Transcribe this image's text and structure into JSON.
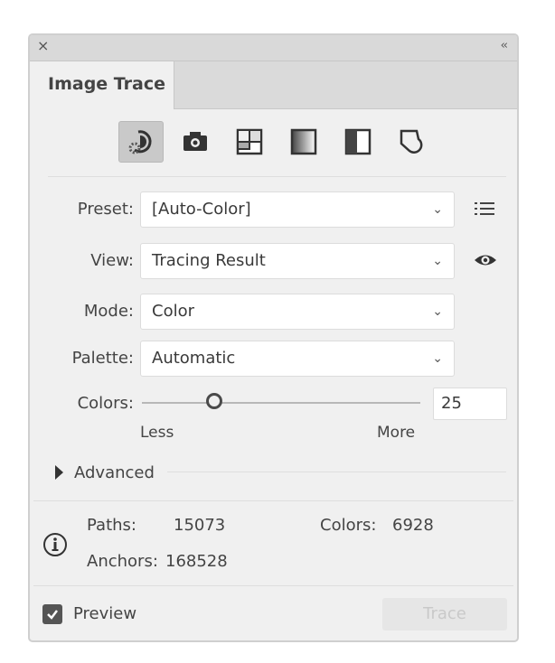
{
  "window": {
    "close_label": "×",
    "collapse_label": "‹‹"
  },
  "tab": {
    "label": "Image Trace"
  },
  "toolbar": {
    "icons": [
      "auto-color-icon",
      "high-color-icon",
      "low-color-icon",
      "grayscale-icon",
      "black-and-white-icon",
      "outline-icon"
    ],
    "active_index": 0
  },
  "preset": {
    "label": "Preset:",
    "value": "[Auto-Color]"
  },
  "view": {
    "label": "View:",
    "value": "Tracing Result"
  },
  "mode": {
    "label": "Mode:",
    "value": "Color"
  },
  "palette": {
    "label": "Palette:",
    "value": "Automatic"
  },
  "colors": {
    "label": "Colors:",
    "value": "25",
    "slider_fraction": 0.26,
    "less_label": "Less",
    "more_label": "More"
  },
  "advanced": {
    "label": "Advanced"
  },
  "stats": {
    "paths_label": "Paths:",
    "paths_value": "15073",
    "colors_label": "Colors:",
    "colors_value": "6928",
    "anchors_label": "Anchors:",
    "anchors_value": "168528"
  },
  "footer": {
    "preview_label": "Preview",
    "preview_checked": true,
    "trace_label": "Trace"
  }
}
